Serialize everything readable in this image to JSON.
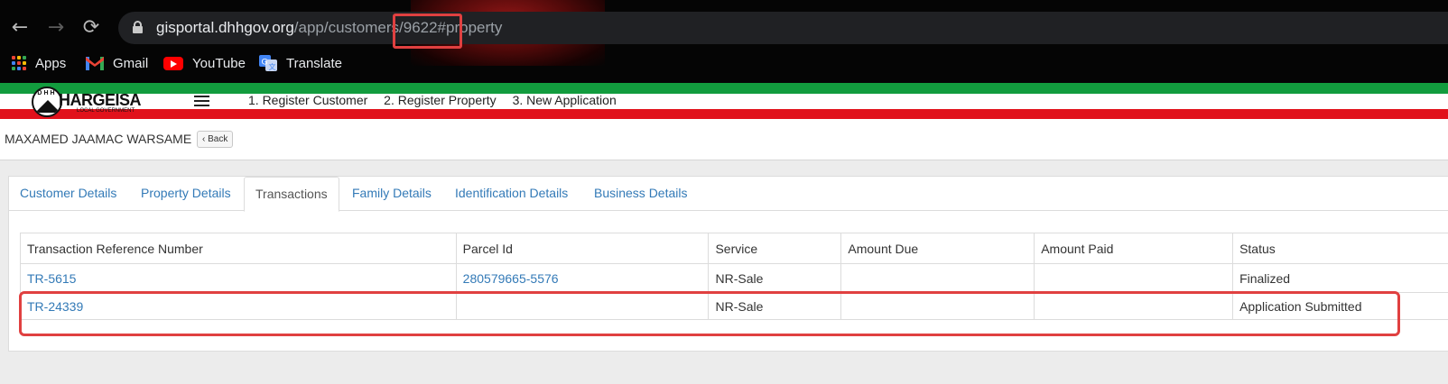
{
  "browser": {
    "url_host": "gisportal.dhhgov.org",
    "url_path": "/app/customers/9622#property",
    "bookmarks": [
      {
        "label": "Apps",
        "icon": "apps-grid-icon"
      },
      {
        "label": "Gmail",
        "icon": "gmail-icon"
      },
      {
        "label": "YouTube",
        "icon": "youtube-icon"
      },
      {
        "label": "Translate",
        "icon": "translate-icon"
      }
    ]
  },
  "header": {
    "logo_name": "HARGEISA",
    "logo_sub": "LOCAL GOVERNMENT",
    "logo_letters": "DHH",
    "steps": [
      "1. Register Customer",
      "2. Register Property",
      "3. New Application"
    ]
  },
  "customer": {
    "name": "MAXAMED JAAMAC WARSAME",
    "back_label": "Back"
  },
  "tabs": [
    {
      "label": "Customer Details",
      "active": false
    },
    {
      "label": "Property Details",
      "active": false
    },
    {
      "label": "Transactions",
      "active": true
    },
    {
      "label": "Family Details",
      "active": false
    },
    {
      "label": "Identification Details",
      "active": false
    },
    {
      "label": "Business Details",
      "active": false
    }
  ],
  "table": {
    "headers": [
      "Transaction Reference Number",
      "Parcel Id",
      "Service",
      "Amount Due",
      "Amount Paid",
      "Status"
    ],
    "rows": [
      [
        "TR-5615",
        "280579665-5576",
        "NR-Sale",
        "",
        "",
        "Finalized"
      ],
      [
        "TR-24339",
        "",
        "NR-Sale",
        "",
        "",
        "Application Submitted"
      ]
    ]
  },
  "colors": {
    "link": "#337ab7",
    "highlight": "#e04040",
    "green_stripe": "#129c3e",
    "red_stripe": "#e1111b"
  }
}
